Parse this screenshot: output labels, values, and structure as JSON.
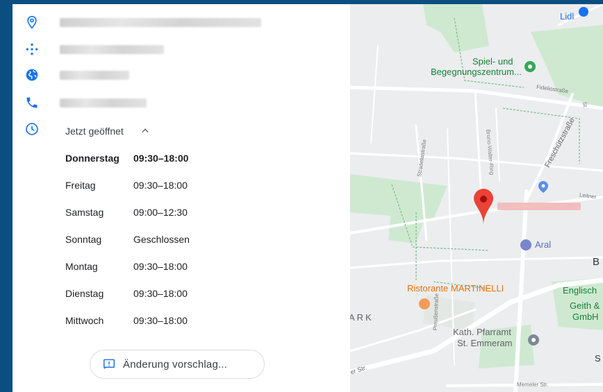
{
  "place": {
    "open_status": "Jetzt geöffnet"
  },
  "hours": [
    {
      "day": "Donnerstag",
      "time": "09:30–18:00",
      "today": true
    },
    {
      "day": "Freitag",
      "time": "09:30–18:00",
      "today": false
    },
    {
      "day": "Samstag",
      "time": "09:00–12:30",
      "today": false
    },
    {
      "day": "Sonntag",
      "time": "Geschlossen",
      "today": false
    },
    {
      "day": "Montag",
      "time": "09:30–18:00",
      "today": false
    },
    {
      "day": "Dienstag",
      "time": "09:30–18:00",
      "today": false
    },
    {
      "day": "Mittwoch",
      "time": "09:30–18:00",
      "today": false
    }
  ],
  "actions": {
    "suggest_edit_label": "Änderung vorschlag..."
  },
  "map": {
    "labels": {
      "lidl": "Lidl",
      "spiel_line1": "Spiel- und",
      "spiel_line2": "Begegnungszentrum...",
      "fidelio": "Fideliostraße",
      "bruno": "Bruno-Walter-Ring",
      "freschutz": "Freschützstraße",
      "strad": "Stradellastraße",
      "leitner": "Leitner",
      "aral": "Aral",
      "b": "B",
      "ristorante": "Ristorante MARTINELLI",
      "englisch": "Englisch",
      "geith1": "Geith &",
      "geith2": "GmbH",
      "ark": "ARK",
      "kath1": "Kath. Pfarramt",
      "kath2": "St. Emmeram",
      "s": "S",
      "str": "er Str.",
      "memeler": "Memeler Str.",
      "pfeuss": "Preußenstraße",
      "st": "St"
    },
    "colors": {
      "pin": "#ea4335",
      "park": "#c8e6c9",
      "road": "#ffffff",
      "water_text": "#1a73e8"
    }
  },
  "colors": {
    "icon_blue": "#1a73e8",
    "frame": "#0a4f7f"
  }
}
